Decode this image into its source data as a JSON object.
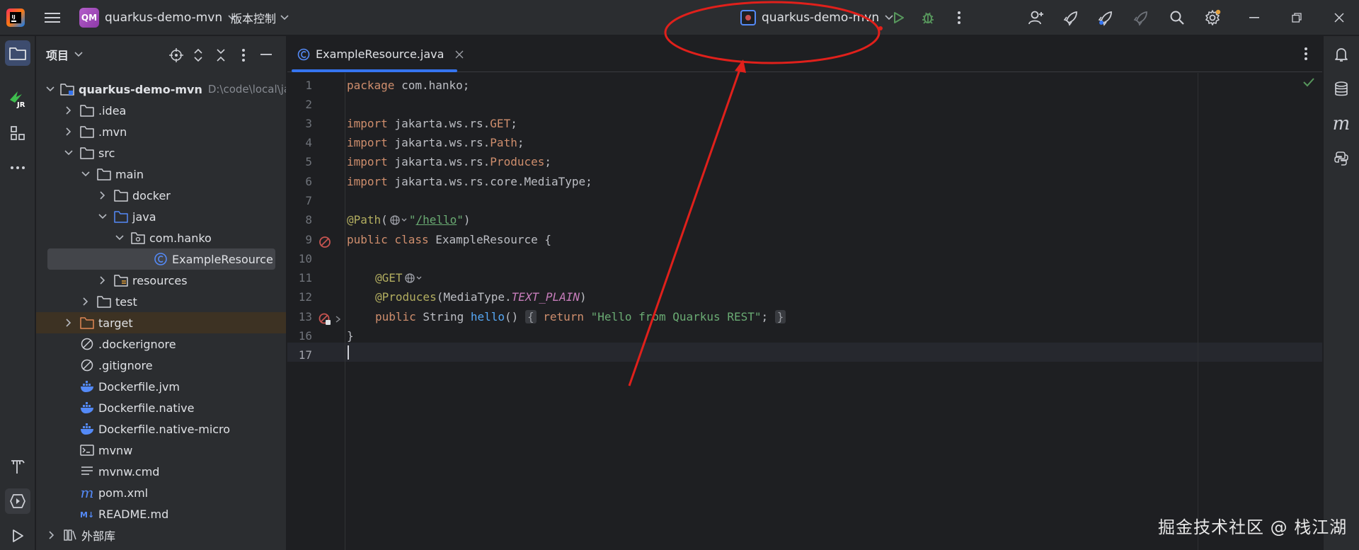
{
  "titlebar": {
    "project_badge": "QM",
    "project_name": "quarkus-demo-mvn",
    "vcs_label": "版本控制",
    "run_config": "quarkus-demo-mvn"
  },
  "project_panel": {
    "title": "项目",
    "tree": [
      {
        "label": "quarkus-demo-mvn",
        "hint": "D:\\code\\local\\java",
        "icon": "module-folder-icon"
      },
      {
        "label": ".idea",
        "icon": "folder-icon"
      },
      {
        "label": ".mvn",
        "icon": "folder-icon"
      },
      {
        "label": "src",
        "icon": "folder-icon"
      },
      {
        "label": "main",
        "icon": "folder-icon"
      },
      {
        "label": "docker",
        "icon": "folder-icon"
      },
      {
        "label": "java",
        "icon": "source-folder-icon"
      },
      {
        "label": "com.hanko",
        "icon": "package-icon"
      },
      {
        "label": "ExampleResource",
        "icon": "java-class-icon"
      },
      {
        "label": "resources",
        "icon": "resources-folder-icon"
      },
      {
        "label": "test",
        "icon": "folder-icon"
      },
      {
        "label": "target",
        "icon": "excluded-folder-icon"
      },
      {
        "label": ".dockerignore",
        "icon": "ignore-file-icon"
      },
      {
        "label": ".gitignore",
        "icon": "ignore-file-icon"
      },
      {
        "label": "Dockerfile.jvm",
        "icon": "docker-icon"
      },
      {
        "label": "Dockerfile.native",
        "icon": "docker-icon"
      },
      {
        "label": "Dockerfile.native-micro",
        "icon": "docker-icon"
      },
      {
        "label": "mvnw",
        "icon": "shell-script-icon"
      },
      {
        "label": "mvnw.cmd",
        "icon": "text-file-icon"
      },
      {
        "label": "pom.xml",
        "icon": "maven-icon"
      },
      {
        "label": "README.md",
        "icon": "markdown-icon"
      },
      {
        "label": "外部库",
        "icon": "library-icon"
      }
    ]
  },
  "editor": {
    "tab_label": "ExampleResource.java",
    "line_numbers": [
      "1",
      "2",
      "3",
      "4",
      "5",
      "6",
      "7",
      "8",
      "9",
      "10",
      "11",
      "12",
      "13",
      "16",
      "17"
    ],
    "code": {
      "l1_kw": "package",
      "l1_rest": " com.hanko;",
      "l3_kw": "import",
      "l3_pkg": " jakarta.ws.rs.",
      "l3_cls": "GET",
      "l3_end": ";",
      "l4_kw": "import",
      "l4_pkg": " jakarta.ws.rs.",
      "l4_cls": "Path",
      "l4_end": ";",
      "l5_kw": "import",
      "l5_pkg": " jakarta.ws.rs.",
      "l5_cls": "Produces",
      "l5_end": ";",
      "l6_kw": "import",
      "l6_rest": " jakarta.ws.rs.core.MediaType;",
      "l8_ann": "@Path",
      "l8_open": "(",
      "l8_str_q1": "\"",
      "l8_str": "/hello",
      "l8_str_q2": "\"",
      "l8_close": ")",
      "l9_kw": "public class",
      "l9_rest": " ExampleResource {",
      "l11_ann": "@GET",
      "l12_ann": "@Produces",
      "l12_open": "(MediaType.",
      "l12_const": "TEXT_PLAIN",
      "l12_close": ")",
      "l13_kw": "public",
      "l13_type": " String ",
      "l13_fn": "hello",
      "l13_parens": "()",
      "l13_brace_open": "{",
      "l13_ret": "return",
      "l13_str": "\"Hello from Quarkus REST\"",
      "l13_semi": ";",
      "l13_brace_close": "}",
      "l16": "}"
    }
  },
  "watermark": "掘金技术社区 @ 栈江湖",
  "colors": {
    "accent": "#3574f0",
    "annotation_red": "#e0201b",
    "run_green": "#57965c"
  }
}
